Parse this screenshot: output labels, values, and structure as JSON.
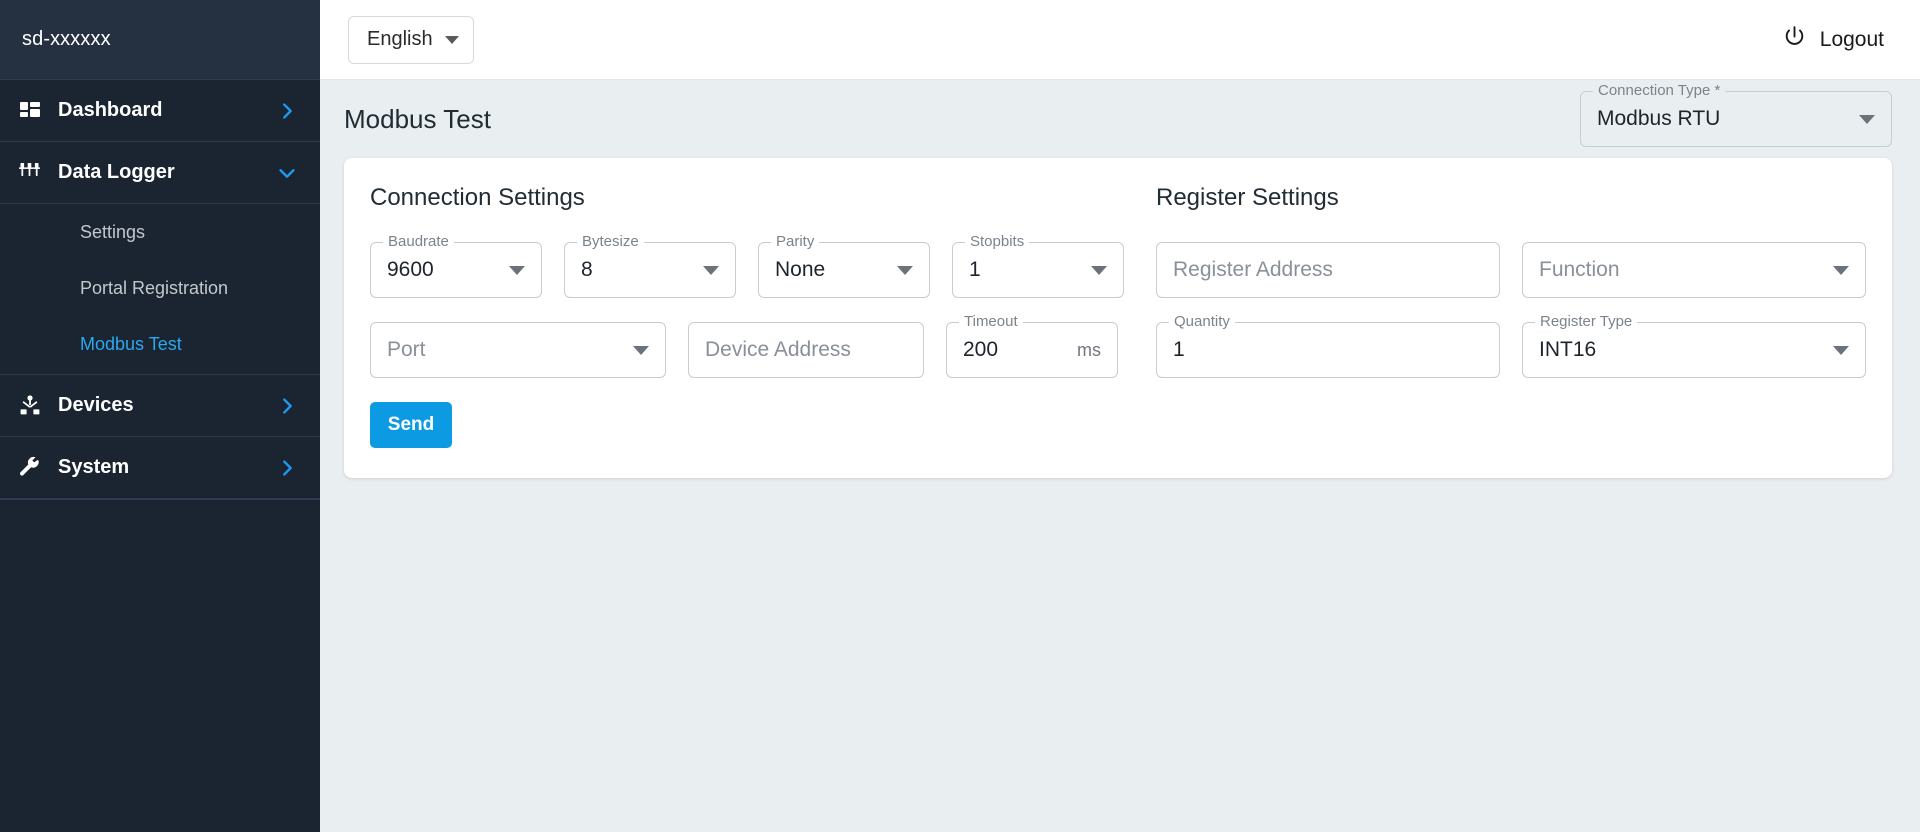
{
  "sidebar": {
    "brand": "sd-xxxxxx",
    "items": [
      {
        "label": "Dashboard",
        "icon": "dashboard-icon",
        "chevron": "chevron-right-icon"
      },
      {
        "label": "Data Logger",
        "icon": "tune-sliders-icon",
        "chevron": "chevron-down-icon"
      },
      {
        "label": "Devices",
        "icon": "device-hub-icon",
        "chevron": "chevron-right-icon"
      },
      {
        "label": "System",
        "icon": "wrench-icon",
        "chevron": "chevron-right-icon"
      }
    ],
    "data_logger_children": [
      {
        "label": "Settings",
        "active": false
      },
      {
        "label": "Portal Registration",
        "active": false
      },
      {
        "label": "Modbus Test",
        "active": true
      }
    ],
    "active_color": "#2ca8ef"
  },
  "topbar": {
    "language": "English",
    "language_icon": "chevron-down-icon",
    "logout_label": "Logout",
    "logout_icon": "power-icon"
  },
  "page": {
    "title": "Modbus Test",
    "connection_type": {
      "label": "Connection Type *",
      "value": "Modbus RTU",
      "icon": "chevron-down-icon"
    }
  },
  "connection_settings": {
    "title": "Connection Settings",
    "fields": [
      {
        "name": "baudrate",
        "label": "Baudrate",
        "value": "9600",
        "type": "select"
      },
      {
        "name": "bytesize",
        "label": "Bytesize",
        "value": "8",
        "type": "select"
      },
      {
        "name": "parity",
        "label": "Parity",
        "value": "None",
        "type": "select"
      },
      {
        "name": "stopbits",
        "label": "Stopbits",
        "value": "1",
        "type": "select"
      },
      {
        "name": "port",
        "label": "",
        "placeholder": "Port",
        "type": "select"
      },
      {
        "name": "device-address",
        "label": "",
        "placeholder": "Device Address",
        "type": "text"
      },
      {
        "name": "timeout",
        "label": "Timeout",
        "value": "200",
        "unit": "ms",
        "type": "text"
      }
    ],
    "send_label": "Send",
    "send_color": "#0c9ae3"
  },
  "register_settings": {
    "title": "Register Settings",
    "fields": [
      {
        "name": "register-address",
        "label": "",
        "placeholder": "Register Address",
        "type": "text"
      },
      {
        "name": "function",
        "label": "",
        "placeholder": "Function",
        "type": "select"
      },
      {
        "name": "quantity",
        "label": "Quantity",
        "value": "1",
        "type": "text"
      },
      {
        "name": "register-type",
        "label": "Register Type",
        "value": "INT16",
        "type": "select"
      }
    ]
  }
}
